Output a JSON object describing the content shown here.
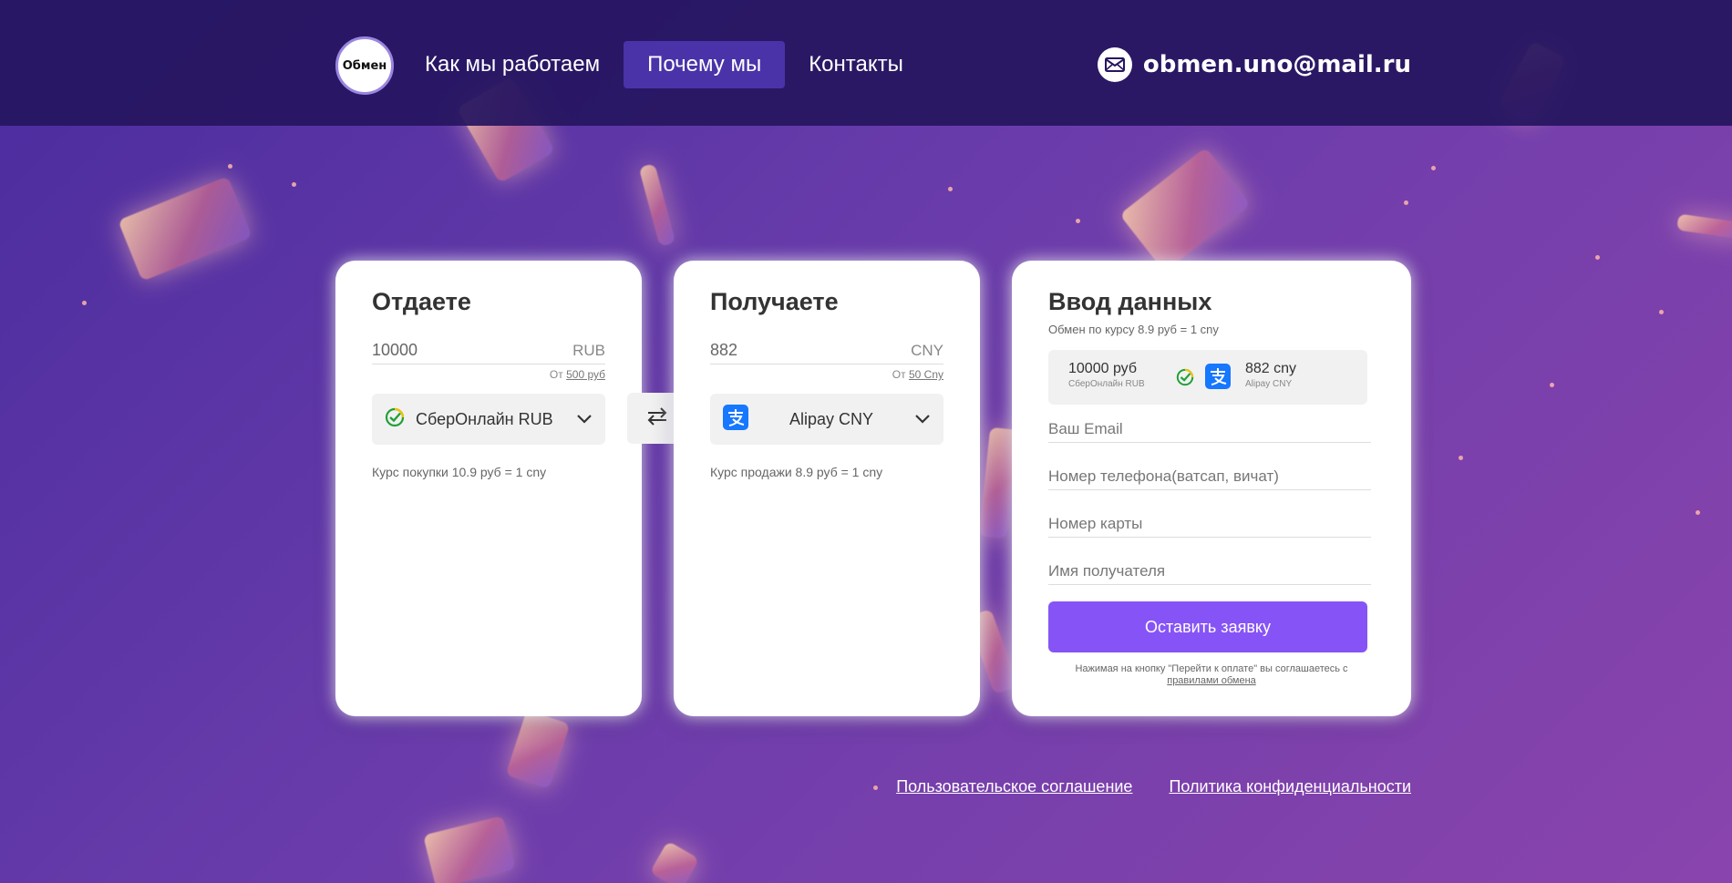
{
  "header": {
    "logo_text": "Обмен",
    "nav": [
      {
        "label": "Как мы работаем"
      },
      {
        "label": "Почему мы"
      },
      {
        "label": "Контакты"
      }
    ],
    "email": "obmen.uno@mail.ru"
  },
  "give": {
    "title": "Отдаете",
    "amount": "10000",
    "currency": "RUB",
    "min_prefix": "От",
    "min_value": "500 руб",
    "method": "СберОнлайн RUB",
    "rate": "Курс покупки 10.9 руб = 1 cny"
  },
  "get": {
    "title": "Получаете",
    "amount": "882",
    "currency": "CNY",
    "min_prefix": "От",
    "min_value": "50 Cny",
    "method": "Alipay CNY",
    "rate": "Курс продажи 8.9 руб = 1 cny"
  },
  "form": {
    "title": "Ввод данных",
    "subtitle": "Обмен по курсу 8.9 руб = 1 cny",
    "summary": {
      "give_amount": "10000 руб",
      "give_method": "СберОнлайн RUB",
      "get_amount": "882 cny",
      "get_method": "Alipay CNY"
    },
    "email_placeholder": "Ваш Email",
    "phone_placeholder": "Номер телефона(ватсап, вичат)",
    "card_placeholder": "Номер карты",
    "name_placeholder": "Имя получателя",
    "submit_label": "Оставить заявку",
    "agree_text": "Нажимая на кнопку \"Перейти к оплате\" вы соглашаетесь с",
    "agree_link": "правилами обмена"
  },
  "footer": {
    "agreement": "Пользовательское соглашение",
    "privacy": "Политика конфиденциальности"
  },
  "colors": {
    "header_bg": "#26165f",
    "nav_active": "#4a33a8",
    "accent_button": "#8654f6",
    "sber_green": "#21a038",
    "alipay_blue": "#1677ff"
  },
  "icons": {
    "mail": "envelope-icon",
    "swap": "swap-arrows-icon",
    "sber": "sber-logo-icon",
    "alipay": "alipay-logo-icon",
    "dropdown": "chevron-down-icon"
  }
}
